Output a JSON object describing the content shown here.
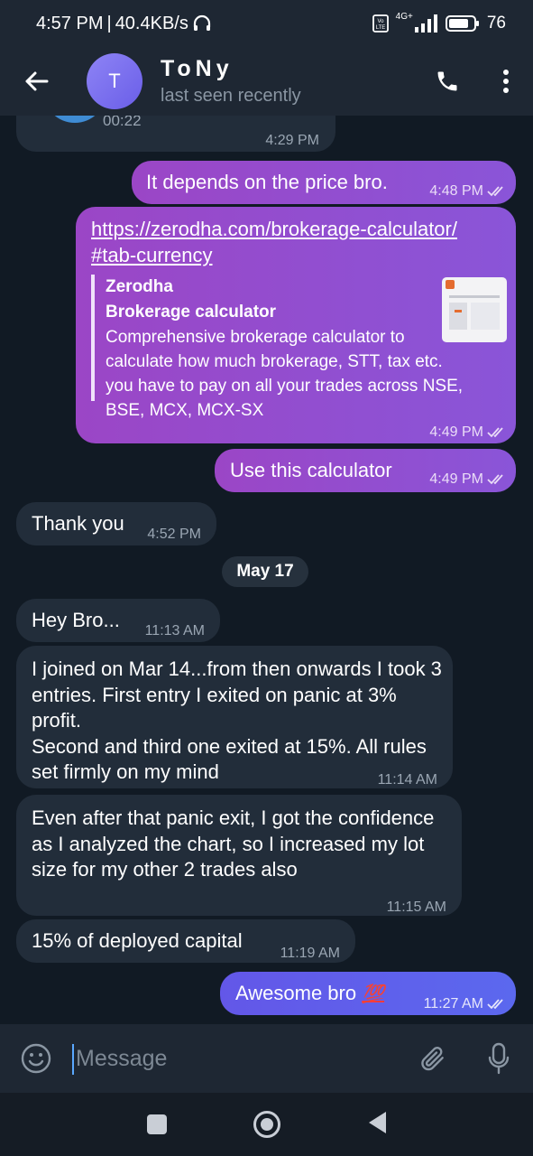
{
  "status": {
    "time": "4:57 PM",
    "speed": "40.4KB/s",
    "network": "4G+",
    "battery": "76"
  },
  "header": {
    "avatar_letter": "T",
    "name": "ToNy",
    "last_seen": "last seen recently"
  },
  "messages": {
    "prev_voice": {
      "duration": "00:22",
      "time": "4:29 PM"
    },
    "m1": {
      "text": "It depends on the price bro.",
      "time": "4:48 PM"
    },
    "m2": {
      "link_line1": "https://zerodha.com/brokerage-calculator/",
      "link_line2": "#tab-currency",
      "preview_site": "Zerodha",
      "preview_title": "Brokerage calculator",
      "preview_desc": "Comprehensive brokerage calculator to calculate how much brokerage, STT, tax etc. you have to pay on all your trades across NSE, BSE, MCX, MCX-SX",
      "time": "4:49 PM"
    },
    "m3": {
      "text": "Use this calculator",
      "time": "4:49 PM"
    },
    "m4": {
      "text": "Thank you",
      "time": "4:52 PM"
    },
    "date_chip": "May 17",
    "m5": {
      "text": "Hey Bro...",
      "time": "11:13 AM"
    },
    "m6": {
      "text": "I joined on Mar 14...from then onwards I took 3 entries. First entry I exited on panic at 3% profit.\nSecond and third one exited at 15%. All rules set firmly on my mind",
      "time": "11:14 AM"
    },
    "m7": {
      "text": "Even after that panic exit, I got the confidence as I analyzed the chart, so I increased my lot size for my other 2 trades also",
      "time": "11:15 AM"
    },
    "m8": {
      "text": "15% of deployed capital",
      "time": "11:19 AM"
    },
    "m9": {
      "text": "Awesome bro",
      "emoji": "💯",
      "time": "11:27 AM"
    }
  },
  "compose": {
    "placeholder": "Message"
  }
}
